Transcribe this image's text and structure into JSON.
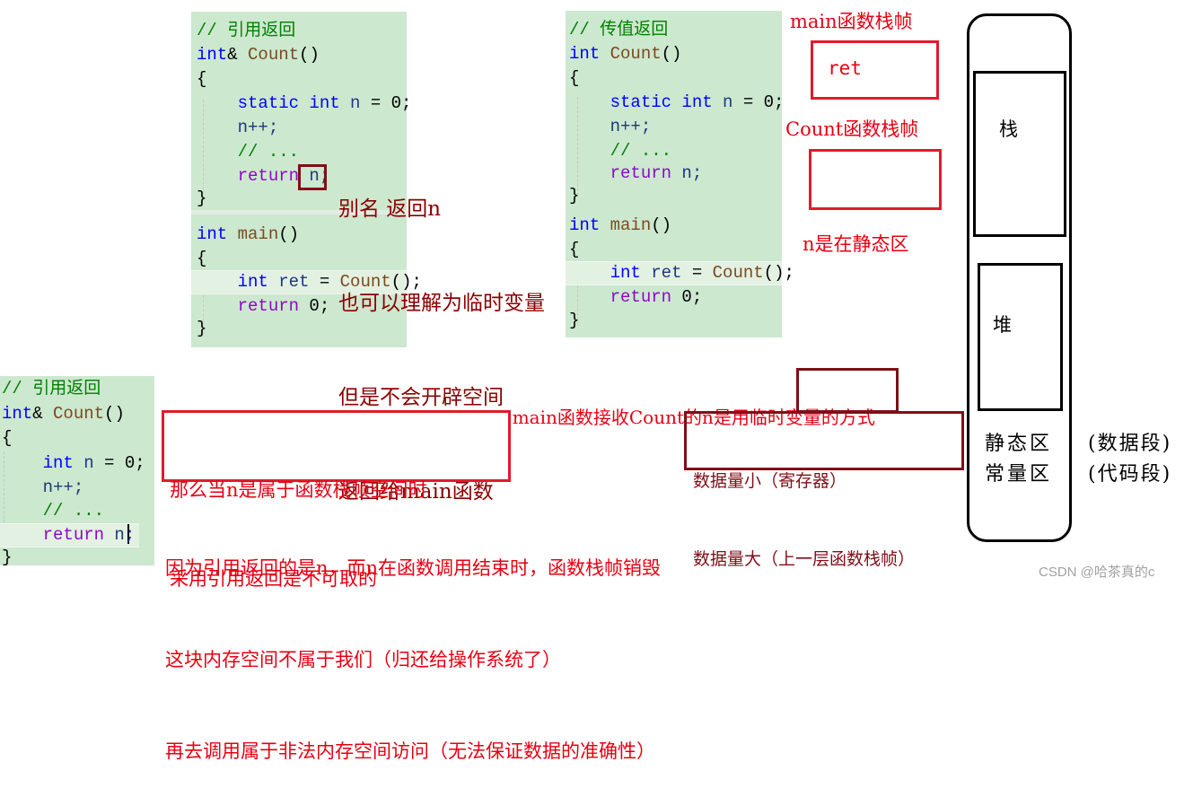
{
  "ref_return_code": {
    "lines": [
      {
        "parts": [
          {
            "t": "// 引用返回",
            "c": "cm"
          }
        ]
      },
      {
        "parts": [
          {
            "t": "int",
            "c": "kw"
          },
          {
            "t": "& ",
            "c": "pl"
          },
          {
            "t": "Count",
            "c": "id"
          },
          {
            "t": "()",
            "c": "pl"
          }
        ]
      },
      {
        "parts": [
          {
            "t": "{",
            "c": "pl"
          }
        ]
      },
      {
        "parts": [
          {
            "t": "    static int ",
            "c": "kw"
          },
          {
            "t": "n",
            "c": "var"
          },
          {
            "t": " = 0;",
            "c": "pl"
          }
        ]
      },
      {
        "parts": [
          {
            "t": "    n++;",
            "c": "var"
          }
        ]
      },
      {
        "parts": [
          {
            "t": "    // ...",
            "c": "cm"
          }
        ]
      },
      {
        "parts": [
          {
            "t": "    return ",
            "c": "pur"
          },
          {
            "t": "n;",
            "c": "var"
          }
        ]
      },
      {
        "parts": [
          {
            "t": "}",
            "c": "pl"
          }
        ]
      },
      {
        "parts": [
          {
            "t": "int ",
            "c": "kw"
          },
          {
            "t": "main",
            "c": "id"
          },
          {
            "t": "()",
            "c": "pl"
          }
        ]
      },
      {
        "parts": [
          {
            "t": "{",
            "c": "pl"
          }
        ]
      },
      {
        "parts": [
          {
            "t": "    int ",
            "c": "kw"
          },
          {
            "t": "ret",
            "c": "var"
          },
          {
            "t": " = ",
            "c": "pl"
          },
          {
            "t": "Count",
            "c": "id"
          },
          {
            "t": "();",
            "c": "pl"
          }
        ]
      },
      {
        "parts": [
          {
            "t": "    return ",
            "c": "pur"
          },
          {
            "t": "0;",
            "c": "pl"
          }
        ]
      },
      {
        "parts": [
          {
            "t": "}",
            "c": "pl"
          }
        ]
      }
    ]
  },
  "value_return_code": {
    "lines": [
      {
        "parts": [
          {
            "t": "// 传值返回",
            "c": "cm"
          }
        ]
      },
      {
        "parts": [
          {
            "t": "int ",
            "c": "kw"
          },
          {
            "t": "Count",
            "c": "id"
          },
          {
            "t": "()",
            "c": "pl"
          }
        ]
      },
      {
        "parts": [
          {
            "t": "{",
            "c": "pl"
          }
        ]
      },
      {
        "parts": [
          {
            "t": "    static int ",
            "c": "kw"
          },
          {
            "t": "n",
            "c": "var"
          },
          {
            "t": " = 0;",
            "c": "pl"
          }
        ]
      },
      {
        "parts": [
          {
            "t": "    n++;",
            "c": "var"
          }
        ]
      },
      {
        "parts": [
          {
            "t": "    // ...",
            "c": "cm"
          }
        ]
      },
      {
        "parts": [
          {
            "t": "    return ",
            "c": "pur"
          },
          {
            "t": "n;",
            "c": "var"
          }
        ]
      },
      {
        "parts": [
          {
            "t": "}",
            "c": "pl"
          }
        ]
      },
      {
        "parts": [
          {
            "t": "int ",
            "c": "kw"
          },
          {
            "t": "main",
            "c": "id"
          },
          {
            "t": "()",
            "c": "pl"
          }
        ]
      },
      {
        "parts": [
          {
            "t": "{",
            "c": "pl"
          }
        ]
      },
      {
        "parts": [
          {
            "t": "    int ",
            "c": "kw"
          },
          {
            "t": "ret",
            "c": "var"
          },
          {
            "t": " = ",
            "c": "pl"
          },
          {
            "t": "Count",
            "c": "id"
          },
          {
            "t": "();",
            "c": "pl"
          }
        ]
      },
      {
        "parts": [
          {
            "t": "    return ",
            "c": "pur"
          },
          {
            "t": "0;",
            "c": "pl"
          }
        ]
      },
      {
        "parts": [
          {
            "t": "}",
            "c": "pl"
          }
        ]
      }
    ]
  },
  "local_ref_code": {
    "lines": [
      {
        "parts": [
          {
            "t": "// 引用返回",
            "c": "cm"
          }
        ]
      },
      {
        "parts": [
          {
            "t": "int",
            "c": "kw"
          },
          {
            "t": "& ",
            "c": "pl"
          },
          {
            "t": "Count",
            "c": "id"
          },
          {
            "t": "()",
            "c": "pl"
          }
        ]
      },
      {
        "parts": [
          {
            "t": "{",
            "c": "pl"
          }
        ]
      },
      {
        "parts": [
          {
            "t": "    int ",
            "c": "kw"
          },
          {
            "t": "n",
            "c": "var"
          },
          {
            "t": " = 0;",
            "c": "pl"
          }
        ]
      },
      {
        "parts": [
          {
            "t": "    n++;",
            "c": "var"
          }
        ]
      },
      {
        "parts": [
          {
            "t": "    // ...",
            "c": "cm"
          }
        ]
      },
      {
        "parts": [
          {
            "t": "    return ",
            "c": "pur"
          },
          {
            "t": "n;",
            "c": "var"
          }
        ]
      },
      {
        "parts": [
          {
            "t": "}",
            "c": "pl"
          }
        ]
      }
    ]
  },
  "alias_note": {
    "lines": [
      "别名 返回n",
      "也可以理解为临时变量",
      "但是不会开辟空间",
      "返回给main函数"
    ]
  },
  "stack_frames": {
    "main_label": "main函数栈帧",
    "main_content": "ret",
    "count_label": "Count函数栈帧",
    "count_content": "",
    "static_note": "n是在静态区"
  },
  "memory_layout": {
    "stack": "栈",
    "heap": "堆",
    "static_area": "静态区",
    "const_area": "常量区",
    "static_segment": "(数据段)",
    "const_segment": "(代码段)"
  },
  "temp_var_note": {
    "prefix": "main函数接收Count的n是用",
    "boxed": "临时变量",
    "suffix": "的方式",
    "details": [
      "数据量小（寄存器）",
      "数据量大（上一层函数栈帧）"
    ]
  },
  "warning_box": {
    "lines": [
      "那么当n是属于函数栈帧空间时",
      "采用引用返回是不可取的"
    ]
  },
  "explanation": {
    "lines": [
      "因为引用返回的是n，而n在函数调用结束时，函数栈帧销毁",
      "这块内存空间不属于我们（归还给操作系统了）",
      "再去调用属于非法内存空间访问（无法保证数据的准确性）"
    ]
  },
  "watermark": "CSDN @哈茶真的c"
}
